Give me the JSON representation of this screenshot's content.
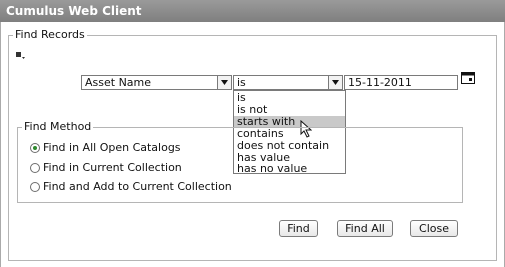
{
  "window": {
    "title": "Cumulus Web Client"
  },
  "find_records": {
    "legend": "Find Records",
    "field_select": "Asset Name",
    "operator_select": "is",
    "date_value": "15-11-2011"
  },
  "operator_options": [
    "is",
    "is not",
    "starts with",
    "contains",
    "does not contain",
    "has value",
    "has no value"
  ],
  "find_method": {
    "legend": "Find Method",
    "options": [
      {
        "label": "Find in All Open Catalogs",
        "checked": true
      },
      {
        "label": "Find in Current Collection",
        "checked": false
      },
      {
        "label": "Find and Add to Current Collection",
        "checked": false
      }
    ]
  },
  "buttons": {
    "find": "Find",
    "find_all": "Find All",
    "close": "Close"
  },
  "icons": {
    "menu": "small-menu-icon",
    "calendar": "calendar-icon",
    "cursor": "mouse-pointer-icon",
    "arrow": "dropdown-arrow-icon"
  },
  "colors": {
    "titlebar": "#8a8a8a",
    "selected_option": "#c9c9c9",
    "radio_checked": "#2f8a2f"
  }
}
